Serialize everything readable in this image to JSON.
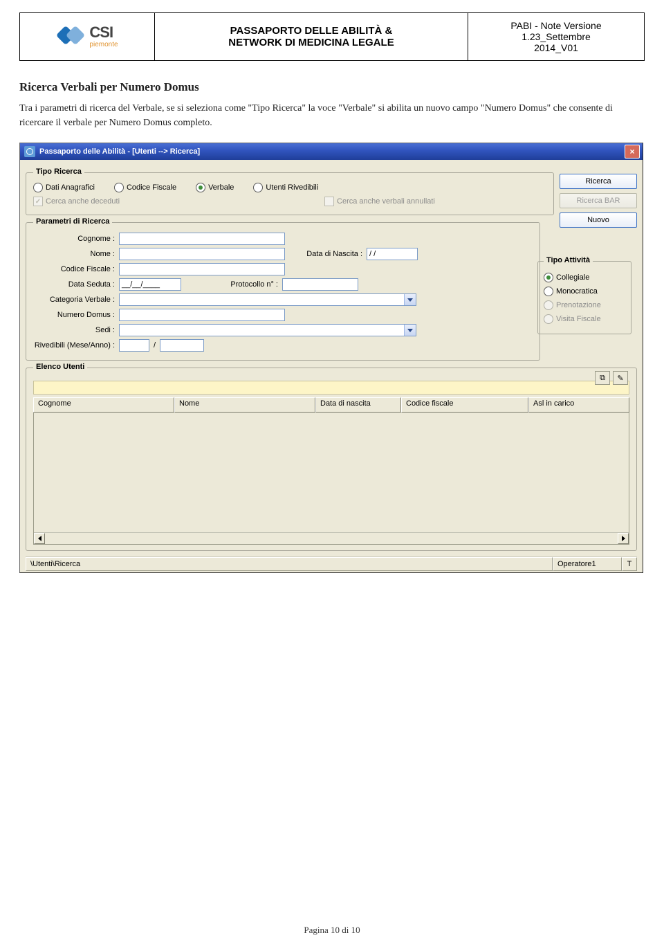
{
  "header": {
    "logo": {
      "csi": "CSI",
      "piemonte": "piemonte"
    },
    "title_line1": "PASSAPORTO DELLE ABILITÀ &",
    "title_line2": "NETWORK DI MEDICINA LEGALE",
    "meta_line1": "PABI - Note Versione",
    "meta_line2": "1.23_Settembre",
    "meta_line3": "2014_V01"
  },
  "section": {
    "title": "Ricerca Verbali per Numero Domus",
    "body": "Tra i parametri di ricerca del Verbale, se si seleziona come \"Tipo Ricerca\" la voce \"Verbale\" si abilita un nuovo campo \"Numero Domus\" che consente di ricercare il verbale per Numero Domus completo."
  },
  "app": {
    "titlebar": "Passaporto delle Abilità - [Utenti --> Ricerca]",
    "close": "×",
    "buttons": {
      "ricerca": "Ricerca",
      "ricerca_bar": "Ricerca BAR",
      "nuovo": "Nuovo"
    },
    "tipo_ricerca": {
      "legend": "Tipo Ricerca",
      "opts": [
        "Dati Anagrafici",
        "Codice Fiscale",
        "Verbale",
        "Utenti Rivedibili"
      ],
      "chk_deceduti": "Cerca anche deceduti",
      "chk_annullati": "Cerca anche verbali annullati"
    },
    "parametri": {
      "legend": "Parametri di Ricerca",
      "cognome": "Cognome :",
      "nome": "Nome :",
      "data_nascita": "Data di Nascita :",
      "data_nascita_val": "  /  /",
      "cod_fisc": "Codice Fiscale :",
      "data_seduta": "Data Seduta :",
      "data_seduta_val": "__/__/____",
      "protocollo": "Protocollo n° :",
      "cat_verbale": "Categoria Verbale :",
      "numero_domus": "Numero Domus :",
      "sedi": "Sedi :",
      "rivedibili": "Rivedibili (Mese/Anno) :",
      "slash": "/"
    },
    "tipo_attivita": {
      "legend": "Tipo Attività",
      "opts": [
        "Collegiale",
        "Monocratica",
        "Prenotazione",
        "Visita Fiscale"
      ]
    },
    "elenco": {
      "legend": "Elenco Utenti",
      "cols": [
        "Cognome",
        "Nome",
        "Data di nascita",
        "Codice fiscale",
        "Asl in carico"
      ],
      "icon1": "⧉",
      "icon2": "✎"
    },
    "status": {
      "path": "\\Utenti\\Ricerca",
      "user": "Operatore1",
      "flag": "T"
    }
  },
  "footer": "Pagina 10 di 10"
}
